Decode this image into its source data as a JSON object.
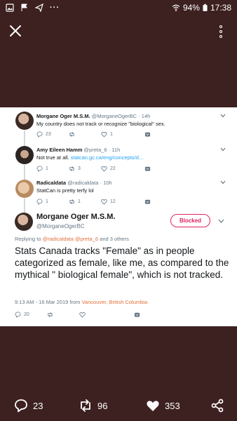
{
  "status_bar": {
    "battery": "94%",
    "time": "17:38",
    "left_icons": [
      "image-icon",
      "flag-icon",
      "send-icon",
      "more-dots-icon"
    ],
    "right_icons": [
      "wifi-icon",
      "battery-icon"
    ]
  },
  "colors": {
    "background": "#3d2020",
    "link": "#1da1f2",
    "accent_orange": "#e36f3a",
    "blocked": "#e0245e",
    "muted": "#657786"
  },
  "thread": [
    {
      "name": "Morgane Oger M.S.M.",
      "handle": "@MorganeOgerBC",
      "time": "· 14h",
      "text": "My country does not track or recognize \"biological\" sex.",
      "link": "",
      "replies": "23",
      "retweets": "",
      "likes": "1"
    },
    {
      "name": "Amy Eileen Hamm",
      "handle": "@preta_6",
      "time": "· 11h",
      "text": "Not true at all. ",
      "link": "statcan.gc.ca/eng/concepts/d…",
      "replies": "1",
      "retweets": "3",
      "likes": "22"
    },
    {
      "name": "Radicaldata",
      "handle": "@radicaldata",
      "time": "· 10h",
      "text": "StatCan is pretty terfy lol",
      "link": "",
      "replies": "1",
      "retweets": "1",
      "likes": "12"
    }
  ],
  "main_tweet": {
    "name": "Morgane Oger M.S.M.",
    "handle": "@MorganeOgerBC",
    "blocked_label": "Blocked",
    "replying_prefix": "Replying to ",
    "replying_handles": "@radicaldata @preta_6",
    "replying_suffix": " and 3 others",
    "text": "Stats Canada tracks \"Female\" as in people categorized as female, like me, as compared to the mythical \" biological female\", which is not tracked.",
    "timestamp": "9:13 AM - 16 Mar 2019 from ",
    "location": "Vancouver, British Columbia",
    "replies": "20"
  },
  "bottom_bar": {
    "replies": "23",
    "retweets": "96",
    "likes": "353"
  }
}
